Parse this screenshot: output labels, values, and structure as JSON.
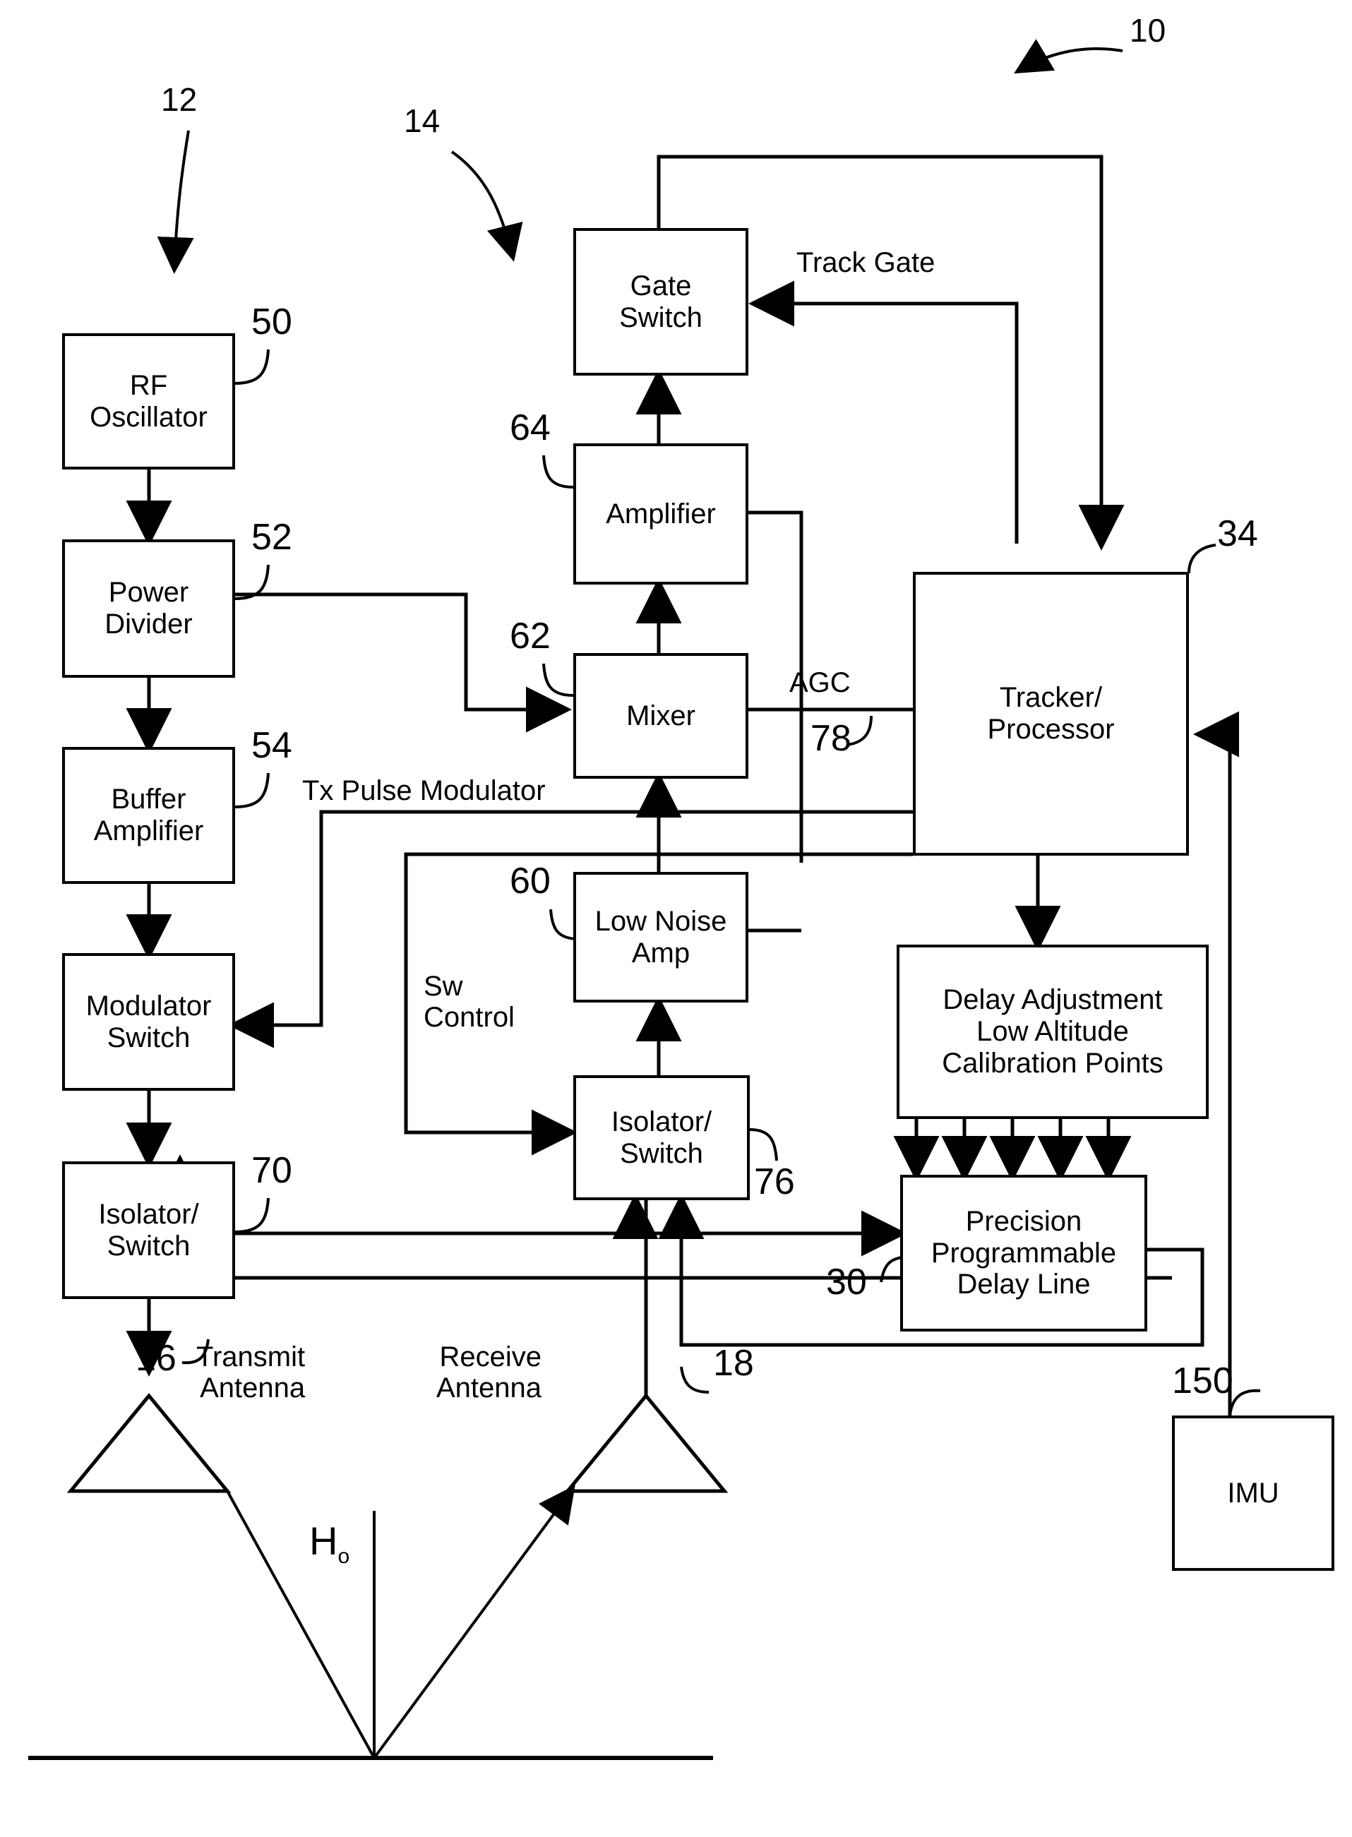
{
  "figure": {
    "type": "patent-block-diagram",
    "system_ref": "10"
  },
  "blocks": [
    {
      "id": "rf_oscillator",
      "label": "RF\nOscillator",
      "ref": "50"
    },
    {
      "id": "power_divider",
      "label": "Power\nDivider",
      "ref": "52"
    },
    {
      "id": "buffer_amplifier",
      "label": "Buffer\nAmplifier",
      "ref": "54"
    },
    {
      "id": "modulator_switch",
      "label": "Modulator\nSwitch",
      "ref": ""
    },
    {
      "id": "isolator_switch_tx",
      "label": "Isolator/\nSwitch",
      "ref": "70"
    },
    {
      "id": "gate_switch",
      "label": "Gate\nSwitch",
      "ref": ""
    },
    {
      "id": "amplifier",
      "label": "Amplifier",
      "ref": "64"
    },
    {
      "id": "mixer",
      "label": "Mixer",
      "ref": "62"
    },
    {
      "id": "low_noise_amp",
      "label": "Low Noise\nAmp",
      "ref": "60"
    },
    {
      "id": "isolator_switch_rx",
      "label": "Isolator/\nSwitch",
      "ref": "76"
    },
    {
      "id": "tracker_processor",
      "label": "Tracker/\nProcessor",
      "ref": "34"
    },
    {
      "id": "delay_adjustment",
      "label": "Delay Adjustment\nLow Altitude\nCalibration Points",
      "ref": ""
    },
    {
      "id": "delay_line",
      "label": "Precision\nProgrammable\nDelay Line",
      "ref": "30"
    },
    {
      "id": "imu",
      "label": "IMU",
      "ref": "150"
    }
  ],
  "signal_labels": {
    "track_gate": "Track Gate",
    "agc": "AGC",
    "agc_ref": "78",
    "tx_pulse_modulator": "Tx Pulse Modulator",
    "sw_control": "Sw\nControl"
  },
  "antennas": [
    {
      "id": "transmit_antenna",
      "label": "Transmit\nAntenna",
      "ref": "16"
    },
    {
      "id": "receive_antenna",
      "label": "Receive\nAntenna",
      "ref": "18"
    }
  ],
  "group_refs": {
    "transmitter": "12",
    "receiver": "14"
  },
  "altitude_symbol": {
    "base": "H",
    "subscript": "o"
  },
  "colors": {
    "ink": "#000000",
    "paper": "#ffffff"
  }
}
